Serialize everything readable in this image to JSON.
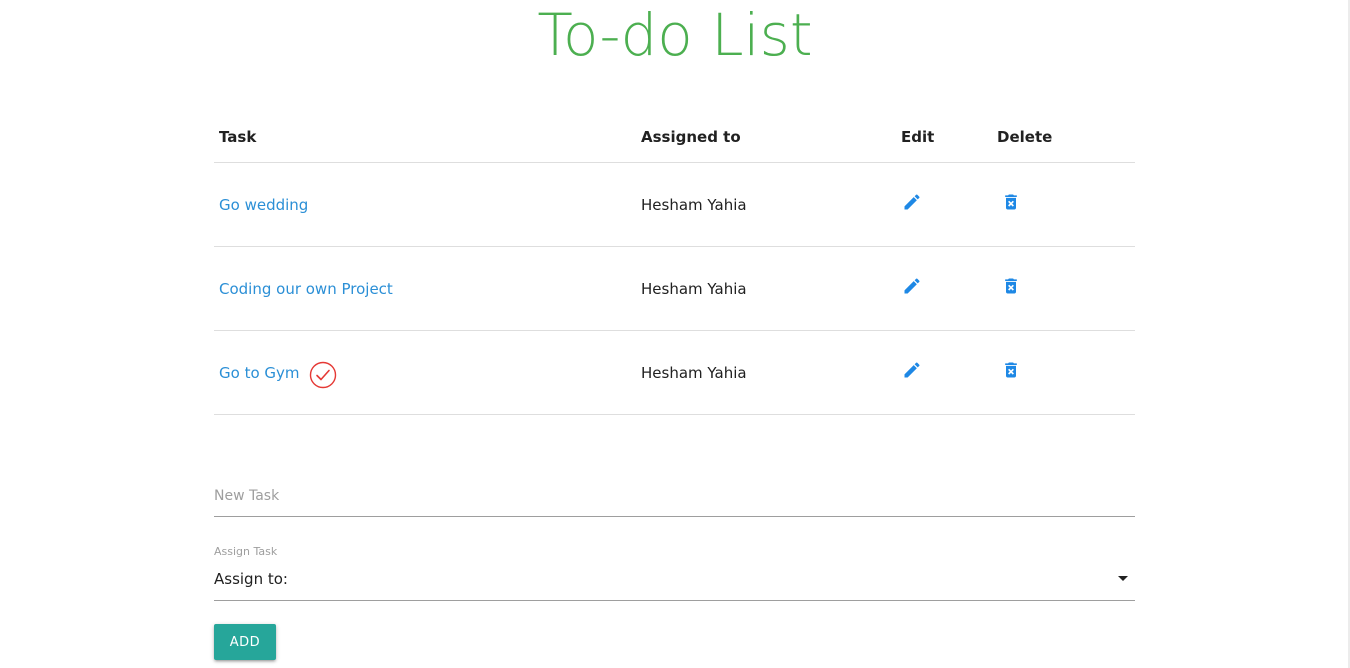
{
  "title": "To-do List",
  "table": {
    "headers": {
      "task": "Task",
      "assigned_to": "Assigned to",
      "edit": "Edit",
      "delete": "Delete"
    },
    "rows": [
      {
        "task": "Go wedding",
        "assigned_to": "Hesham Yahia",
        "done": false
      },
      {
        "task": "Coding our own Project",
        "assigned_to": "Hesham Yahia",
        "done": false
      },
      {
        "task": "Go to Gym",
        "assigned_to": "Hesham Yahia",
        "done": true
      }
    ]
  },
  "form": {
    "new_task_placeholder": "New Task",
    "assign_label": "Assign Task",
    "assign_select_value": "Assign to:",
    "add_button": "ADD"
  },
  "icons": {
    "edit": "pencil-icon",
    "delete": "trash-icon",
    "done": "check-circle-icon",
    "select": "caret-down-icon"
  },
  "colors": {
    "title": "#4caf50",
    "link": "#2b8fd6",
    "icon": "#1e88e5",
    "done_mark": "#e53935",
    "button": "#26a69a"
  }
}
